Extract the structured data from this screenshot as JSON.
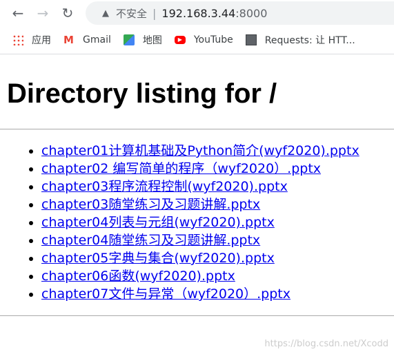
{
  "browser": {
    "security_label": "不安全",
    "url_host": "192.168.3.44",
    "url_port": ":8000",
    "bookmarks": [
      {
        "label": "应用",
        "icon": "apps-icon"
      },
      {
        "label": "Gmail",
        "icon": "gmail-icon"
      },
      {
        "label": "地图",
        "icon": "maps-icon"
      },
      {
        "label": "YouTube",
        "icon": "youtube-icon"
      },
      {
        "label": "Requests: 让 HTT...",
        "icon": "document-icon"
      }
    ]
  },
  "page": {
    "title": "Directory listing for /",
    "files": [
      "chapter01计算机基础及Python简介(wyf2020).pptx",
      "chapter02 编写简单的程序（wyf2020）.pptx",
      "chapter03程序流程控制(wyf2020).pptx",
      "chapter03随堂练习及习题讲解.pptx",
      "chapter04列表与元组(wyf2020).pptx",
      "chapter04随堂练习及习题讲解.pptx",
      "chapter05字典与集合(wyf2020).pptx",
      "chapter06函数(wyf2020).pptx",
      "chapter07文件与异常（wyf2020）.pptx"
    ]
  },
  "watermark": "https://blog.csdn.net/Xcodd",
  "colors": {
    "link": "#0000ee"
  }
}
